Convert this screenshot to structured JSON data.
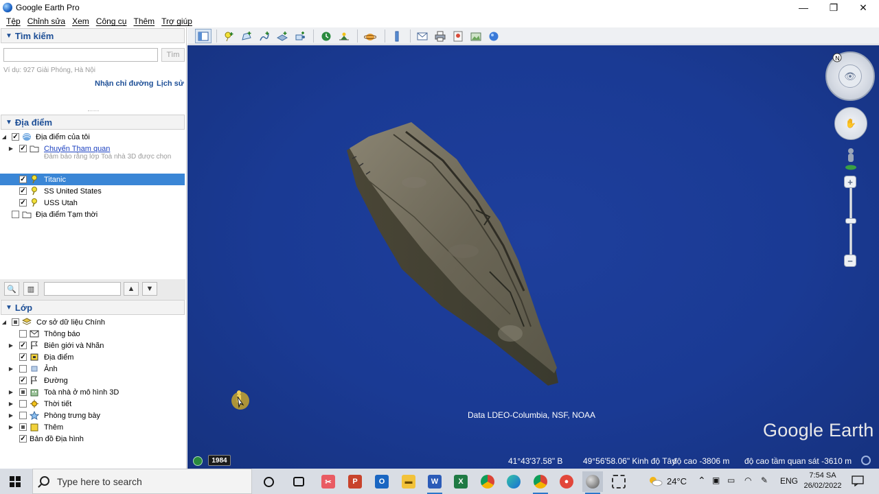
{
  "window": {
    "title": "Google Earth Pro",
    "controls": {
      "minimize": "—",
      "restore": "❐",
      "close": "✕"
    }
  },
  "menu": [
    "Tệp",
    "Chỉnh sửa",
    "Xem",
    "Công cụ",
    "Thêm",
    "Trợ giúp"
  ],
  "search": {
    "header": "Tìm kiếm",
    "input_value": "",
    "button": "Tìm",
    "hint": "Ví dụ: 927 Giải Phóng, Hà Nội",
    "links": [
      "Nhận chỉ đường",
      "Lịch sử"
    ]
  },
  "places": {
    "header": "Địa điểm",
    "items": [
      {
        "label": "Địa điểm của tôi"
      },
      {
        "label": "Chuyến Tham quan",
        "note": "Đảm bảo rằng lớp Toà nhà 3D được chọn"
      },
      {
        "label": "Titanic"
      },
      {
        "label": "SS United States"
      },
      {
        "label": "USS Utah"
      },
      {
        "label": "Địa điểm Tạm thời"
      }
    ],
    "toolbar_input": ""
  },
  "layers": {
    "header": "Lớp",
    "items": [
      "Cơ sở dữ liệu Chính",
      "Thông báo",
      "Biên giới và Nhãn",
      "Địa điểm",
      "Ảnh",
      "Đường",
      "Toà nhà ở mô hình 3D",
      "Thời tiết",
      "Phòng trưng bày",
      "Thêm",
      "Bản đồ Địa hình"
    ]
  },
  "map": {
    "attribution": "Data LDEO-Columbia, NSF, NOAA",
    "logo": "Google Earth",
    "year": "1984",
    "status": {
      "lat": "41°43'37.58\" B",
      "lon": "49°56'58.06\" Kinh độ Tây",
      "elevation": "độ cao -3806 m",
      "eye_alt": "độ cao tầm quan sát -3610 m"
    },
    "colors": {
      "ocean": "#1a3a94",
      "wreck": "#6b6656"
    }
  },
  "taskbar": {
    "search_placeholder": "Type here to search",
    "weather": "24°C",
    "lang": "ENG",
    "time": "7:54 SA",
    "date": "26/02/2022"
  }
}
